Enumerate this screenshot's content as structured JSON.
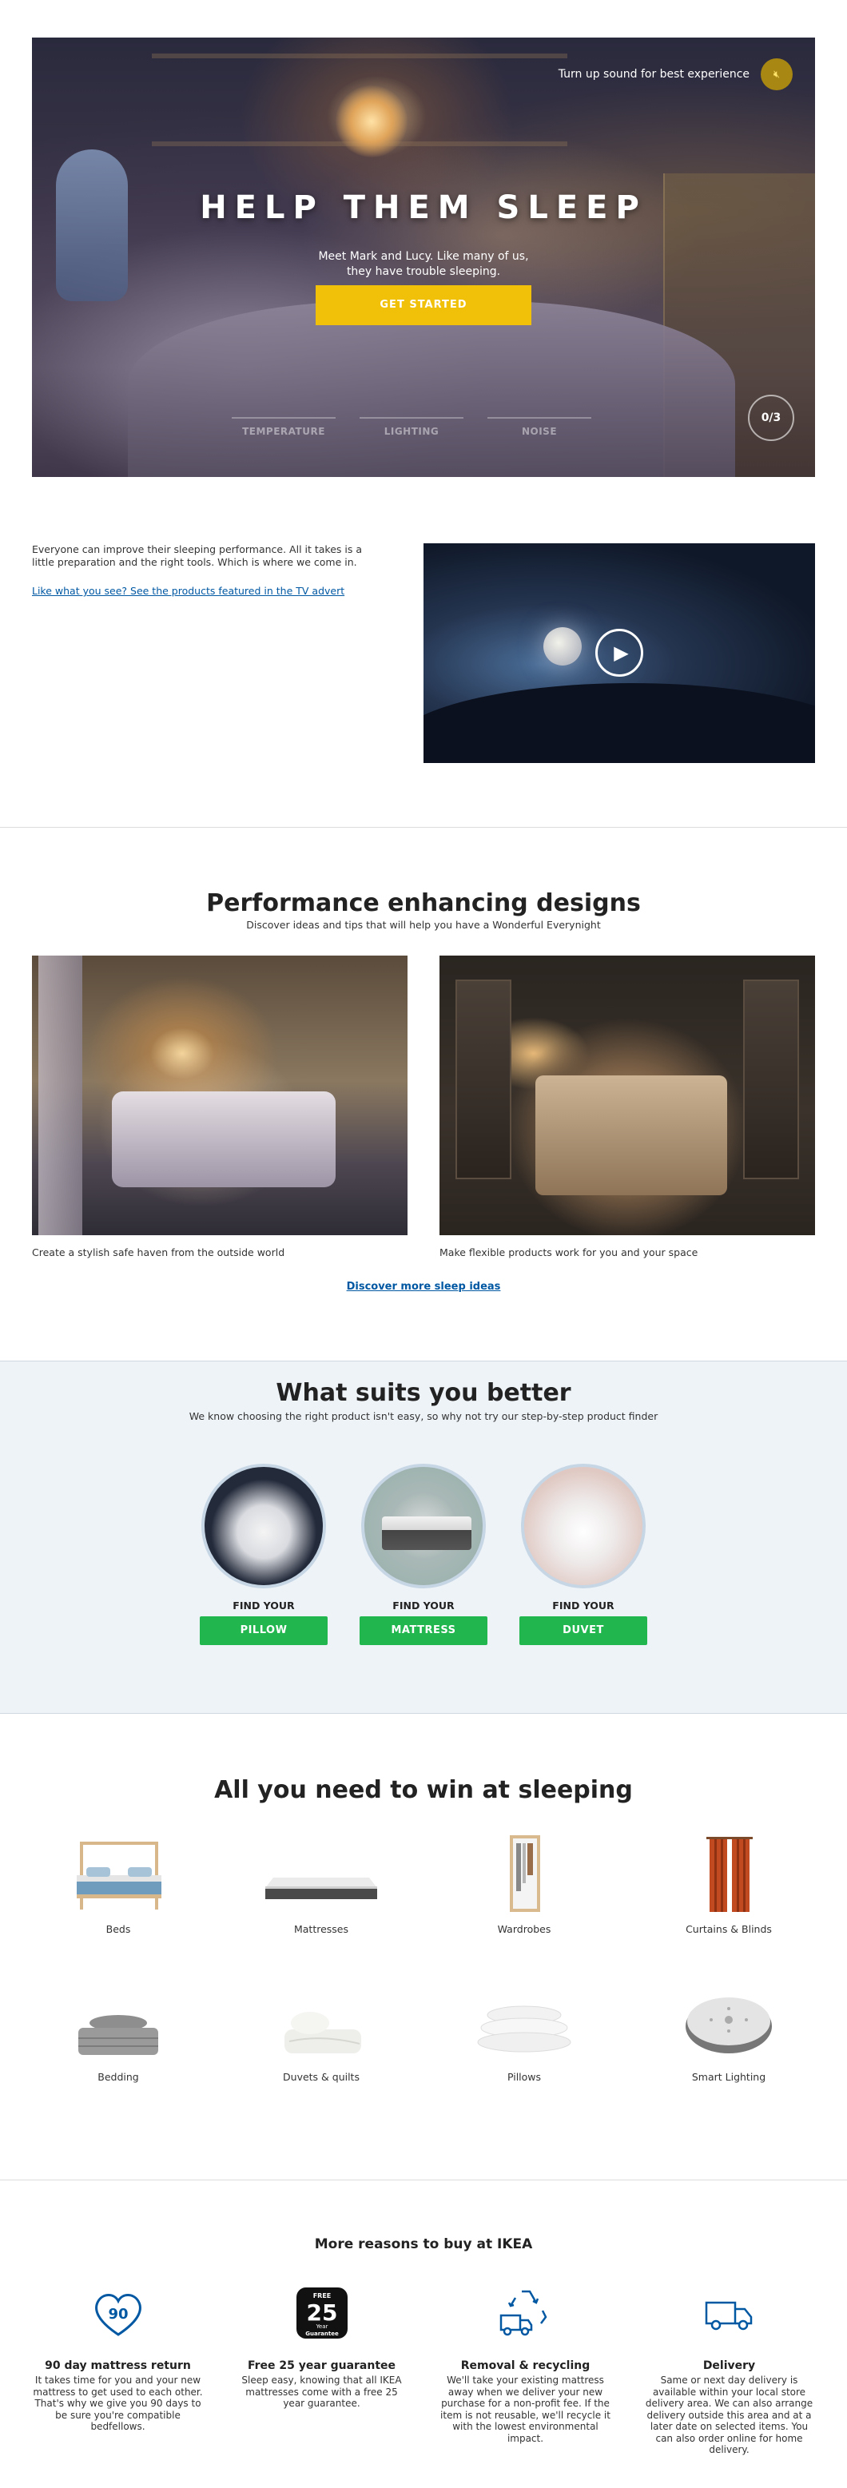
{
  "hero": {
    "sound_text": "Turn up sound for best experience",
    "title": "HELP THEM SLEEP",
    "subtitle_line1": "Meet Mark and Lucy. Like many of us,",
    "subtitle_line2": "they have trouble sleeping.",
    "cta": "GET STARTED",
    "tabs": [
      "TEMPERATURE",
      "LIGHTING",
      "NOISE"
    ],
    "counter": "0/3"
  },
  "intro": {
    "text": "Everyone can improve their sleeping performance. All it takes is a little preparation and the right tools. Which is where we come in.",
    "link": "Like what you see? See the products featured in the TV advert"
  },
  "designs": {
    "title": "Performance enhancing designs",
    "subtitle": "Discover ideas and tips that will help you have a Wonderful Everynight",
    "items": [
      {
        "caption": "Create a stylish safe haven from the outside world"
      },
      {
        "caption": "Make flexible products work for you and your space"
      }
    ],
    "discover_link": "Discover more sleep ideas"
  },
  "finder": {
    "title": "What suits you better",
    "subtitle": "We know choosing the right product isn't easy, so why not try our step-by-step product finder",
    "items": [
      {
        "label": "FIND YOUR",
        "button": "PILLOW"
      },
      {
        "label": "FIND YOUR",
        "button": "MATTRESS"
      },
      {
        "label": "FIND YOUR",
        "button": "DUVET"
      }
    ]
  },
  "categories": {
    "title": "All you need to win at sleeping",
    "items": [
      {
        "label": "Beds",
        "icon": "bed-icon"
      },
      {
        "label": "Mattresses",
        "icon": "mattress-icon"
      },
      {
        "label": "Wardrobes",
        "icon": "wardrobe-icon"
      },
      {
        "label": "Curtains & Blinds",
        "icon": "curtains-icon"
      },
      {
        "label": "Bedding",
        "icon": "bedding-icon"
      },
      {
        "label": "Duvets & quilts",
        "icon": "duvet-icon"
      },
      {
        "label": "Pillows",
        "icon": "pillows-icon"
      },
      {
        "label": "Smart Lighting",
        "icon": "smart-light-icon"
      }
    ]
  },
  "reasons": {
    "title": "More reasons to buy at IKEA",
    "items": [
      {
        "title": "90 day mattress return",
        "text": "It takes time for you and your new mattress to get used to each other. That's why we give you 90 days to be sure you're compatible bedfellows.",
        "badge": "90"
      },
      {
        "title": "Free 25 year guarantee",
        "text": "Sleep easy, knowing that all IKEA mattresses come with a free 25 year guarantee.",
        "badge_top": "FREE",
        "badge_num": "25",
        "badge_mid": "Year",
        "badge_bottom": "Guarantee"
      },
      {
        "title": "Removal & recycling",
        "text": "We'll take your existing mattress away when we deliver your new purchase for a non-profit fee. If the item is not reusable, we'll recycle it with the lowest environmental impact."
      },
      {
        "title": "Delivery",
        "text": "Same or next day delivery is available within your local store delivery area. We can also arrange delivery outside this area and at a later date on selected items. You can also order online for home delivery."
      }
    ]
  },
  "colors": {
    "accent_yellow": "#f1c10a",
    "link_blue": "#0058a3",
    "cta_green": "#22b64f",
    "icon_blue": "#0058a3"
  }
}
